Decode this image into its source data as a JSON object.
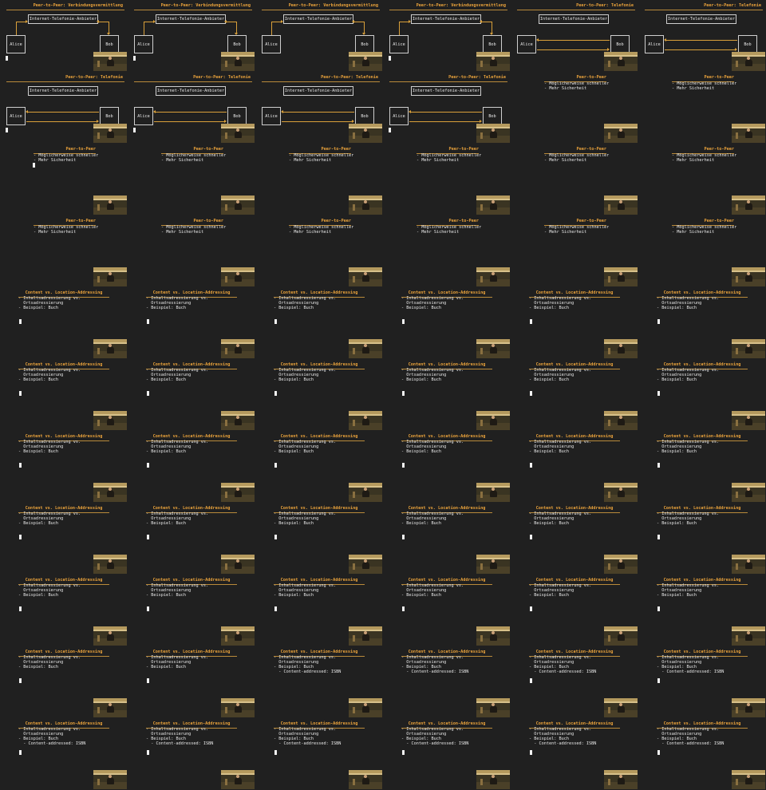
{
  "slides": {
    "connect": {
      "title": "Peer-to-Peer: Verbindungsvermittlung",
      "provider": "Internet-Telefonie-Anbieter",
      "alice": "Alice",
      "bob": "Bob"
    },
    "phone": {
      "title": "Peer-to-Peer: Telefonie",
      "provider": "Internet-Telefonie-Anbieter",
      "alice": "Alice",
      "bob": "Bob"
    },
    "p2p": {
      "title": "Peer-to-Peer",
      "bullets": [
        "- Möglicherweise schneller",
        "- Mehr Sicherheit"
      ]
    },
    "addr": {
      "title": "Content vs. Location-Addressing",
      "bullets": [
        "- Inhaltsadressierung vs.",
        "  Ortsadressierung",
        "- Beispiel: Buch"
      ]
    },
    "addr2": {
      "title": "Content vs. Location-Addressing",
      "bullets": [
        "- Inhaltsadressierung vs.",
        "  Ortsadressierung",
        "- Beispiel: Buch",
        "  - Content-addressed: ISBN"
      ]
    }
  },
  "frames": [
    {
      "slide": "connect",
      "cursor": true
    },
    {
      "slide": "connect",
      "cursor": true
    },
    {
      "slide": "connect",
      "cursor": false
    },
    {
      "slide": "connect",
      "cursor": true
    },
    {
      "slide": "phone",
      "cursor": false
    },
    {
      "slide": "phone",
      "cursor": false
    },
    {
      "slide": "phone",
      "cursor": true
    },
    {
      "slide": "phone",
      "cursor": true
    },
    {
      "slide": "phone",
      "cursor": false
    },
    {
      "slide": "phone",
      "cursor": true
    },
    {
      "slide": "p2p",
      "cursor": false
    },
    {
      "slide": "p2p",
      "cursor": false
    },
    {
      "slide": "p2p",
      "cursor": true
    },
    {
      "slide": "p2p",
      "cursor": false
    },
    {
      "slide": "p2p",
      "cursor": false
    },
    {
      "slide": "p2p",
      "cursor": false
    },
    {
      "slide": "p2p",
      "cursor": false
    },
    {
      "slide": "p2p",
      "cursor": false
    },
    {
      "slide": "p2p",
      "cursor": false
    },
    {
      "slide": "p2p",
      "cursor": false
    },
    {
      "slide": "p2p",
      "cursor": false
    },
    {
      "slide": "p2p",
      "cursor": false
    },
    {
      "slide": "p2p",
      "cursor": false
    },
    {
      "slide": "p2p",
      "cursor": false
    },
    {
      "slide": "addr",
      "cursor": true
    },
    {
      "slide": "addr",
      "cursor": true
    },
    {
      "slide": "addr",
      "cursor": true
    },
    {
      "slide": "addr",
      "cursor": true
    },
    {
      "slide": "addr",
      "cursor": true
    },
    {
      "slide": "addr",
      "cursor": true
    },
    {
      "slide": "addr",
      "cursor": true
    },
    {
      "slide": "addr",
      "cursor": true
    },
    {
      "slide": "addr",
      "cursor": true
    },
    {
      "slide": "addr",
      "cursor": true
    },
    {
      "slide": "addr",
      "cursor": true
    },
    {
      "slide": "addr",
      "cursor": true
    },
    {
      "slide": "addr",
      "cursor": true
    },
    {
      "slide": "addr",
      "cursor": true
    },
    {
      "slide": "addr",
      "cursor": true
    },
    {
      "slide": "addr",
      "cursor": true
    },
    {
      "slide": "addr",
      "cursor": true
    },
    {
      "slide": "addr",
      "cursor": true
    },
    {
      "slide": "addr",
      "cursor": true
    },
    {
      "slide": "addr",
      "cursor": true
    },
    {
      "slide": "addr",
      "cursor": true
    },
    {
      "slide": "addr",
      "cursor": true
    },
    {
      "slide": "addr",
      "cursor": true
    },
    {
      "slide": "addr",
      "cursor": true
    },
    {
      "slide": "addr",
      "cursor": true
    },
    {
      "slide": "addr",
      "cursor": true
    },
    {
      "slide": "addr",
      "cursor": true
    },
    {
      "slide": "addr",
      "cursor": true
    },
    {
      "slide": "addr",
      "cursor": true
    },
    {
      "slide": "addr",
      "cursor": true
    },
    {
      "slide": "addr",
      "cursor": true
    },
    {
      "slide": "addr",
      "cursor": true
    },
    {
      "slide": "addr2",
      "cursor": false
    },
    {
      "slide": "addr2",
      "cursor": false
    },
    {
      "slide": "addr2",
      "cursor": true
    },
    {
      "slide": "addr2",
      "cursor": true
    },
    {
      "slide": "addr2",
      "cursor": true
    },
    {
      "slide": "addr2",
      "cursor": true
    },
    {
      "slide": "addr2",
      "cursor": true
    },
    {
      "slide": "addr2",
      "cursor": true
    },
    {
      "slide": "addr2",
      "cursor": true
    },
    {
      "slide": "addr2",
      "cursor": true
    }
  ],
  "colors": {
    "background": "#202020",
    "accent": "#e9a23b",
    "text": "#e8e8e8",
    "box_border": "#cfcfcf",
    "arrow": "#d9a03a"
  },
  "icons": {
    "cursor": "text-cursor-icon",
    "arrow": "arrowhead-icon"
  }
}
